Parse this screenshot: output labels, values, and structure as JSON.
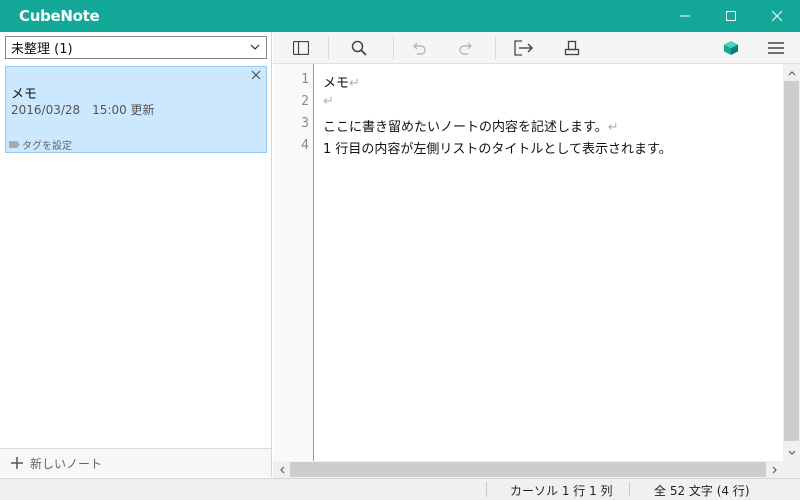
{
  "app": {
    "title": "CubeNote"
  },
  "window_controls": {
    "minimize_icon": "minimize-icon",
    "maximize_icon": "maximize-icon",
    "close_icon": "close-icon"
  },
  "sidebar": {
    "folder": "未整理 (1)",
    "notes": [
      {
        "title": "メモ",
        "date": "2016/03/28　15:00 更新",
        "tag": "タグを設定"
      }
    ],
    "new_note": "新しいノート"
  },
  "toolbar": {
    "icons": [
      "sidebar-toggle-icon",
      "search-icon",
      "undo-icon",
      "redo-icon",
      "export-icon",
      "print-icon",
      "cube-icon",
      "menu-icon"
    ]
  },
  "editor": {
    "line_numbers": [
      "1",
      "2",
      "3",
      "4"
    ],
    "lines": [
      "メモ",
      "",
      "ここに書き留めたいノートの内容を記述します。",
      "1 行目の内容が左側リストのタイトルとして表示されます。"
    ],
    "return_mark": "↵"
  },
  "status": {
    "cursor": "カーソル 1 行 1 列",
    "count": "全 52 文字 (4 行)"
  },
  "colors": {
    "accent": "#13a898",
    "selection": "#cce8ff"
  }
}
